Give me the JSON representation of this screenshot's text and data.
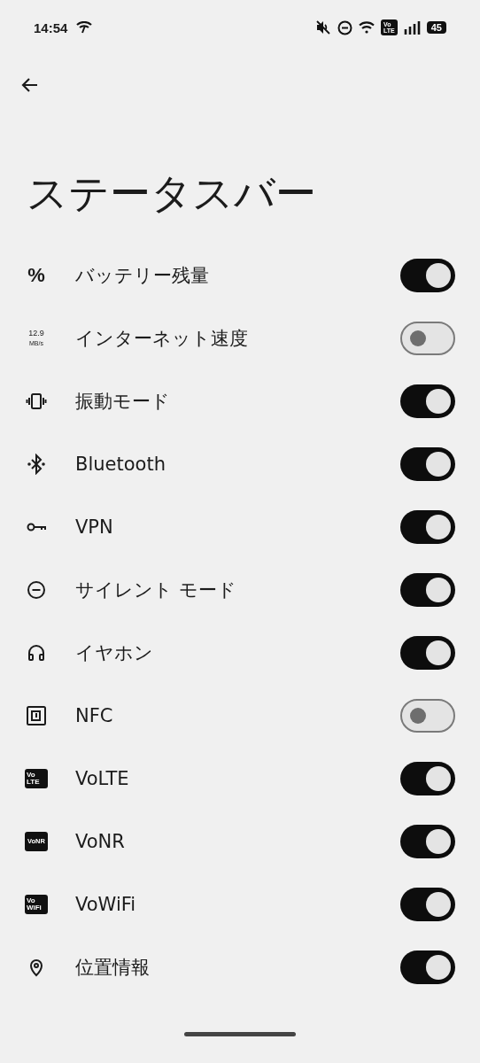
{
  "status_bar": {
    "time": "14:54",
    "volte_badge": [
      "Vo",
      "LTE"
    ],
    "battery": "45"
  },
  "title": "ステータスバー",
  "rows": [
    {
      "kind": "text",
      "icon_text": [
        "%"
      ],
      "label": "バッテリー残量",
      "on": true
    },
    {
      "kind": "speed",
      "icon_text": [
        "12.9",
        "MB/s"
      ],
      "label": "インターネット速度",
      "on": false
    },
    {
      "kind": "vibrate",
      "label": "振動モード",
      "on": true
    },
    {
      "kind": "bluetooth",
      "label": "Bluetooth",
      "on": true
    },
    {
      "kind": "key",
      "label": "VPN",
      "on": true
    },
    {
      "kind": "dnd",
      "label": "サイレント モード",
      "on": true
    },
    {
      "kind": "headphones",
      "label": "イヤホン",
      "on": true
    },
    {
      "kind": "nfc",
      "label": "NFC",
      "on": false
    },
    {
      "kind": "badge",
      "icon_text": [
        "Vo",
        "LTE"
      ],
      "label": "VoLTE",
      "on": true
    },
    {
      "kind": "badge",
      "icon_text": [
        "VoNR"
      ],
      "label": "VoNR",
      "on": true
    },
    {
      "kind": "badge",
      "icon_text": [
        "Vo",
        "WiFi"
      ],
      "label": "VoWiFi",
      "on": true
    },
    {
      "kind": "pin",
      "label": "位置情報",
      "on": true
    }
  ]
}
